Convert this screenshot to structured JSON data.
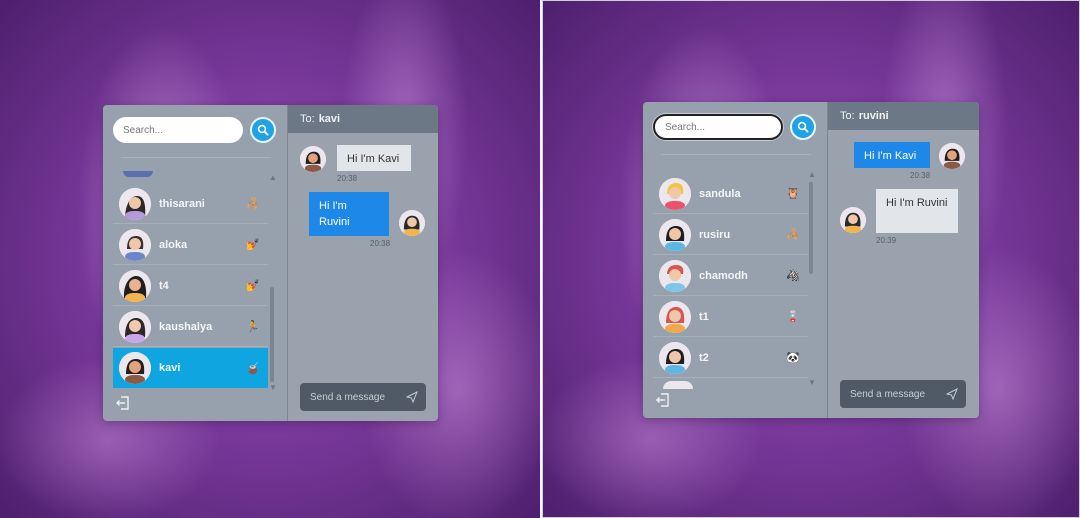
{
  "left": {
    "search": {
      "placeholder": "Search..."
    },
    "contacts": [
      {
        "name": "thisarani",
        "emoji": "🦂",
        "hair": "#2a2a2a",
        "skin": "#f0c7a8",
        "shirt": "#b59ad8"
      },
      {
        "name": "aloka",
        "emoji": "💅",
        "hair": "#3a3030",
        "skin": "#f0c7a8",
        "shirt": "#6c86c9"
      },
      {
        "name": "t4",
        "emoji": "💅",
        "hair": "#1f1f1f",
        "skin": "#eab38e",
        "shirt": "#f2b54c"
      },
      {
        "name": "kaushalya",
        "emoji": "🏃",
        "hair": "#2a2a2a",
        "skin": "#f2c9ab",
        "shirt": "#c8a6e8"
      },
      {
        "name": "kavi",
        "emoji": "🧉",
        "hair": "#1f1f1f",
        "skin": "#e4a27a",
        "shirt": "#8a5a44"
      }
    ],
    "chat": {
      "to_label": "To:",
      "recipient": "kavi",
      "messages": [
        {
          "text": "Hi I'm Kavi",
          "time": "20:38",
          "dir": "in"
        },
        {
          "text": "Hi I'm Ruvini",
          "time": "20:38",
          "dir": "out"
        }
      ],
      "composer_placeholder": "Send a message"
    }
  },
  "right": {
    "search": {
      "placeholder": "Search..."
    },
    "contacts": [
      {
        "name": "sandula",
        "emoji": "🦉",
        "hair": "#f4c542",
        "skin": "#f0c7a8",
        "shirt": "#e9536b"
      },
      {
        "name": "rusiru",
        "emoji": "🦂",
        "hair": "#1f1f1f",
        "skin": "#f0c7a8",
        "shirt": "#5bb8e6"
      },
      {
        "name": "chamodh",
        "emoji": "🦓",
        "hair": "#d9534f",
        "skin": "#f0c7a8",
        "shirt": "#7fc7e8"
      },
      {
        "name": "t1",
        "emoji": "🪫",
        "hair": "#d9534f",
        "skin": "#f0c7a8",
        "shirt": "#f2a74c"
      },
      {
        "name": "t2",
        "emoji": "🐼",
        "hair": "#1f1f1f",
        "skin": "#f0c7a8",
        "shirt": "#5bb8e6"
      }
    ],
    "chat": {
      "to_label": "To:",
      "recipient": "ruvini",
      "messages": [
        {
          "text": "Hi I'm Kavi",
          "time": "20:38",
          "dir": "out"
        },
        {
          "text": "Hi I'm Ruvini",
          "time": "20:39",
          "dir": "in"
        }
      ],
      "composer_placeholder": "Send a message"
    }
  },
  "colors": {
    "accent": "#1fa2e6",
    "active_row": "#0ea5e0",
    "bubble_out": "#1e88e8",
    "sidebar": "#97a0ad",
    "header": "#6d7886"
  }
}
